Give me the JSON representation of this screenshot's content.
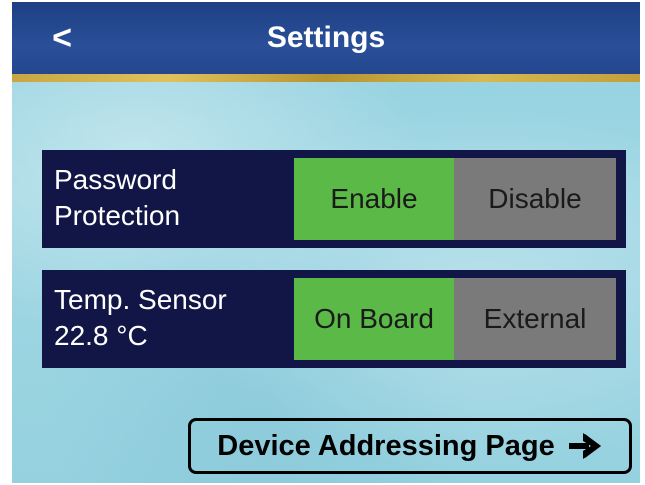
{
  "header": {
    "back_label": "<",
    "title": "Settings"
  },
  "settings": [
    {
      "label_line1": "Password",
      "label_line2": "Protection",
      "options": [
        "Enable",
        "Disable"
      ],
      "selected": "Enable"
    },
    {
      "label_line1": "Temp. Sensor",
      "label_line2": "22.8 °C",
      "options": [
        "On Board",
        "External"
      ],
      "selected": "On Board"
    }
  ],
  "footer": {
    "nav_label": "Device Addressing Page",
    "nav_icon": "arrow-right-icon"
  },
  "colors": {
    "header_bg": "#24478f",
    "header_accent": "#c9a640",
    "panel_bg": "#121646",
    "selected_option": "#5bb947",
    "unselected_option": "#7a7a7a",
    "background": "#9dd5e2"
  }
}
